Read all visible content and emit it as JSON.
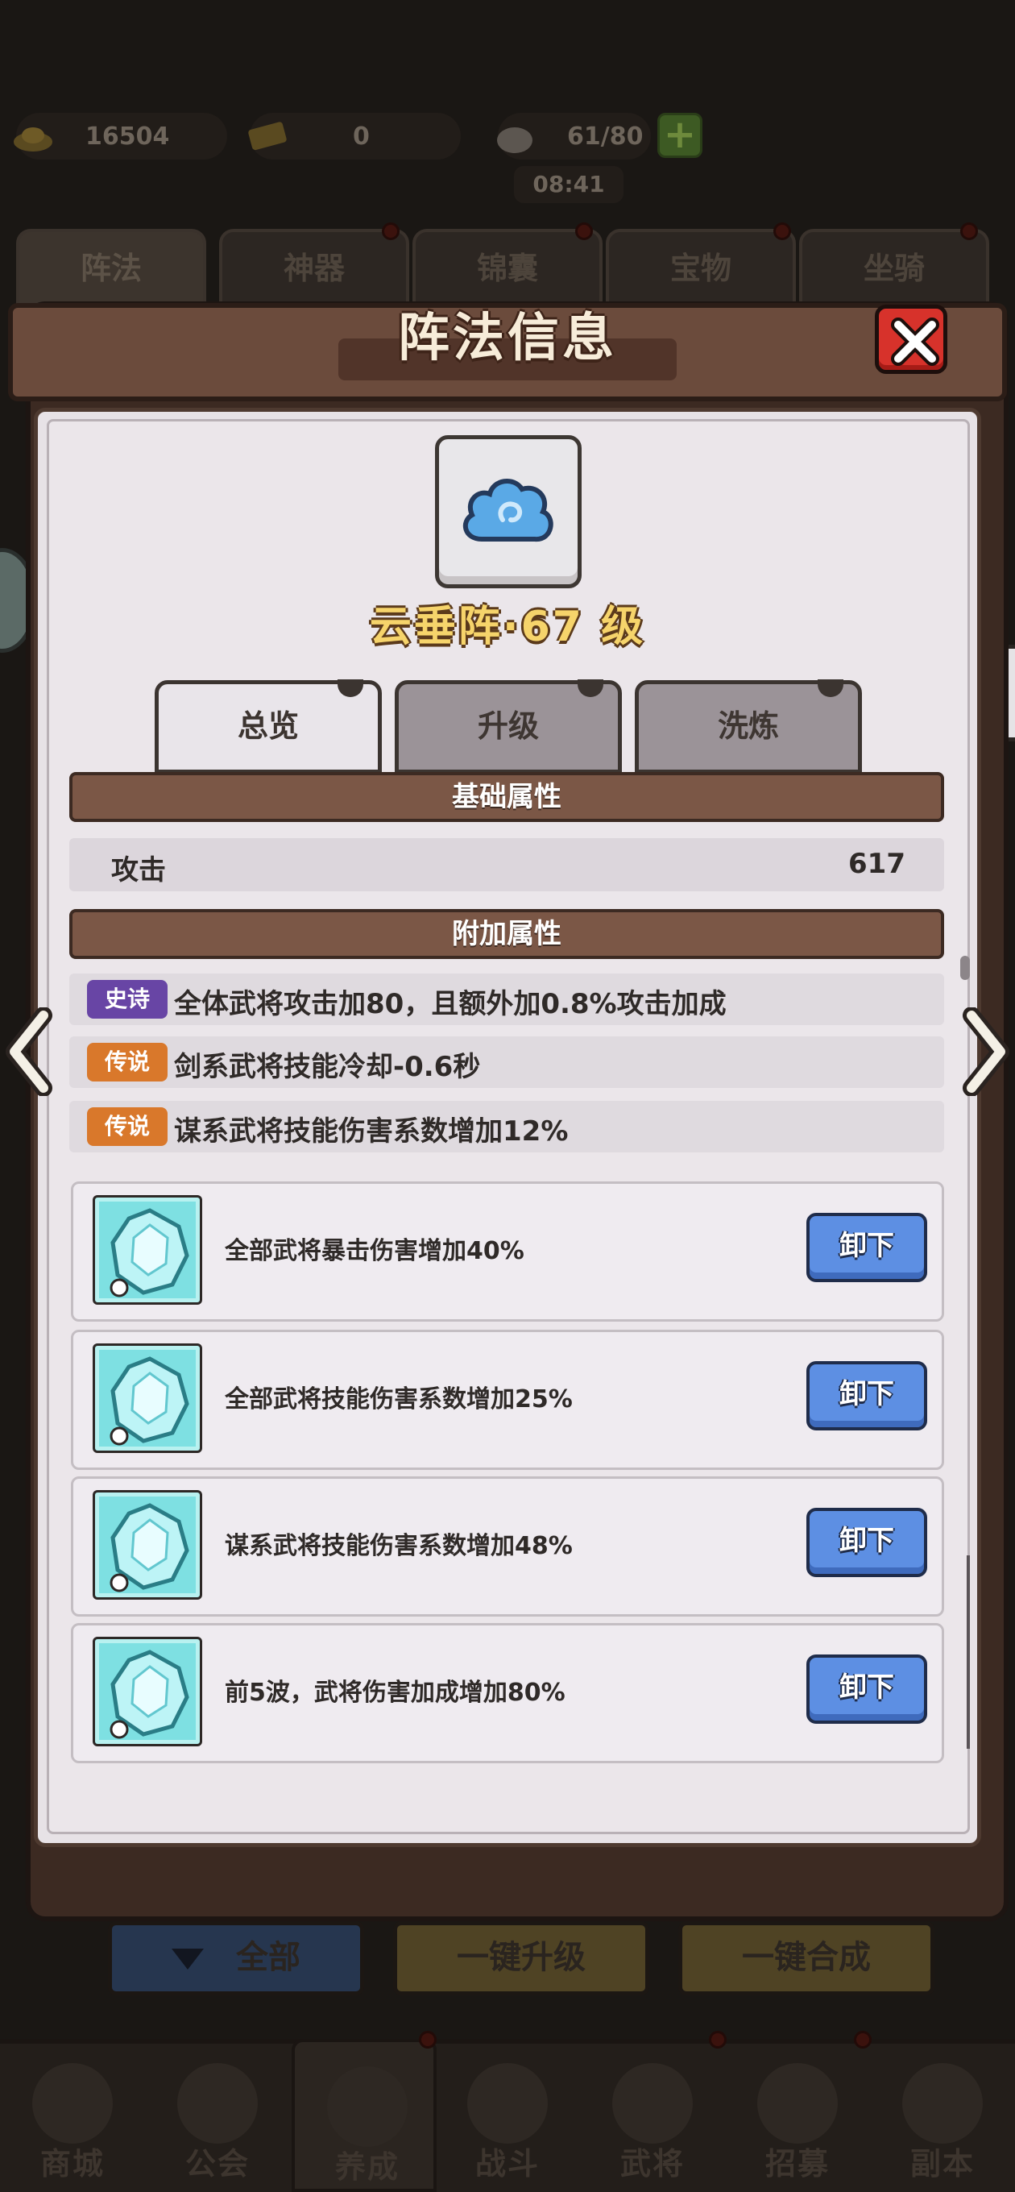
{
  "resources": {
    "gold": "16504",
    "ticket": "0",
    "stamina": "61/80",
    "timer": "08:41"
  },
  "top_tabs": [
    "阵法",
    "神器",
    "锦囊",
    "宝物",
    "坐骑"
  ],
  "modal": {
    "title": "阵法信息",
    "formation_name": "云垂阵·67 级",
    "tabs": [
      "总览",
      "升级",
      "洗炼"
    ],
    "base_section": "基础属性",
    "base_stats": [
      {
        "label": "攻击",
        "value": "617"
      }
    ],
    "extra_section": "附加属性",
    "extra_attrs": [
      {
        "rarity": "史诗",
        "text": "全体武将攻击加80，且额外加0.8%攻击加成"
      },
      {
        "rarity": "传说",
        "text": "剑系武将技能冷却-0.6秒"
      },
      {
        "rarity": "传说",
        "text": "谋系武将技能伤害系数增加12%"
      }
    ],
    "gems": [
      {
        "desc": "全部武将暴击伤害增加40%",
        "action": "卸下"
      },
      {
        "desc": "全部武将技能伤害系数增加25%",
        "action": "卸下"
      },
      {
        "desc": "谋系武将技能伤害系数增加48%",
        "action": "卸下"
      },
      {
        "desc": "前5波，武将伤害加成增加80%",
        "action": "卸下"
      }
    ]
  },
  "bottom_buttons": [
    "全部",
    "一键升级",
    "一键合成"
  ],
  "bottom_nav": [
    "商城",
    "公会",
    "养成",
    "战斗",
    "武将",
    "招募",
    "副本"
  ],
  "colors": {
    "epic": "#6845a5",
    "legend": "#d9782b",
    "unequip": "#5d8fe3",
    "title_gold": "#f6d46b",
    "close_red": "#d7322b"
  }
}
